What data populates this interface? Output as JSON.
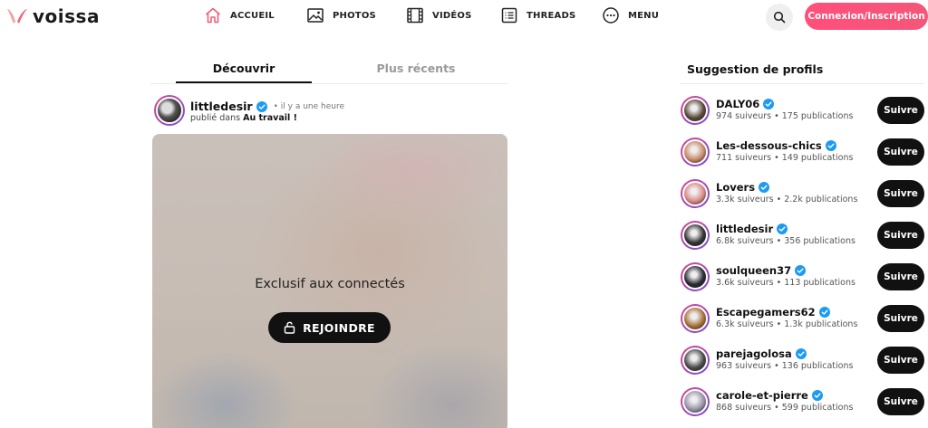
{
  "brand": {
    "name": "voissa",
    "accent": "#ff4f7b"
  },
  "nav": {
    "items": [
      {
        "label": "ACCUEIL",
        "icon": "home-icon"
      },
      {
        "label": "PHOTOS",
        "icon": "image-icon"
      },
      {
        "label": "VIDÉOS",
        "icon": "film-icon"
      },
      {
        "label": "THREADS",
        "icon": "list-icon"
      },
      {
        "label": "MENU",
        "icon": "more-icon"
      }
    ],
    "login_label": "Connexion/Inscription"
  },
  "tabs": {
    "discover": "Découvrir",
    "recent": "Plus récents",
    "active": "Découvrir"
  },
  "post": {
    "author": "littledesir",
    "time": "• il y a une heure",
    "published_prefix": "publié dans",
    "category": "Au travail !",
    "overlay_text": "Exclusif aux connectés",
    "join_label": "REJOINDRE"
  },
  "suggestions": {
    "title": "Suggestion de profils",
    "follow_label": "Suivre",
    "profiles": [
      {
        "name": "DALY06",
        "stats": "974 suiveurs • 175 publications",
        "avatar_color": "#5a4a3a"
      },
      {
        "name": "Les-dessous-chics",
        "stats": "711 suiveurs • 149 publications",
        "avatar_color": "#c98a6a"
      },
      {
        "name": "Lovers",
        "stats": "3.3k suiveurs • 2.2k publications",
        "avatar_color": "#d98a86"
      },
      {
        "name": "littledesir",
        "stats": "6.8k suiveurs • 356 publications",
        "avatar_color": "#333333"
      },
      {
        "name": "soulqueen37",
        "stats": "3.6k suiveurs • 113 publications",
        "avatar_color": "#2a2a33"
      },
      {
        "name": "Escapegamers62",
        "stats": "6.3k suiveurs • 1.3k publications",
        "avatar_color": "#a8713a"
      },
      {
        "name": "parejagolosa",
        "stats": "963 suiveurs • 136 publications",
        "avatar_color": "#4a4a4a"
      },
      {
        "name": "carole-et-pierre",
        "stats": "868 suiveurs • 599 publications",
        "avatar_color": "#9a94a8"
      }
    ]
  }
}
